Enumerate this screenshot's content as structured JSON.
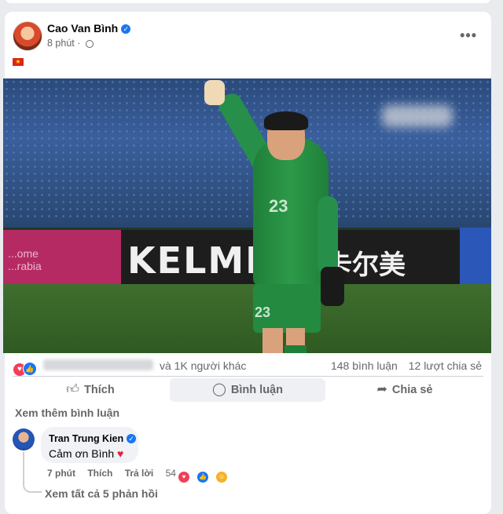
{
  "post": {
    "author": "Cao Van Bình",
    "time": "8 phút",
    "flag_emoji": "🇻🇳",
    "photo_texts": {
      "banner_brand": "KELME",
      "banner_cn": "卡尔美",
      "banner_pink": "...ome\n...rabia",
      "jersey_number": "23"
    }
  },
  "engagement": {
    "others_text": "và 1K người khác",
    "comments_count": "148 bình luận",
    "shares_count": "12 lượt chia sẻ"
  },
  "actions": {
    "like": "Thích",
    "comment": "Bình luận",
    "share": "Chia sẻ"
  },
  "comments_section": {
    "see_more": "Xem thêm bình luận",
    "comment": {
      "author": "Tran Trung Kien",
      "text": "Cảm ơn Bình",
      "heart": "❤️",
      "time": "7 phút",
      "like_action": "Thích",
      "reply_action": "Trả lời",
      "reaction_count": "54"
    },
    "view_replies": "Xem tất cả 5 phản hồi"
  },
  "icons": [
    "more-icon",
    "globe-icon",
    "verified-icon",
    "like-icon",
    "comment-icon",
    "share-icon",
    "heart-reaction-icon",
    "like-reaction-icon",
    "care-reaction-icon"
  ],
  "colors": {
    "accent": "#1877f2",
    "heart": "#f33e58",
    "text_secondary": "#65676b"
  }
}
